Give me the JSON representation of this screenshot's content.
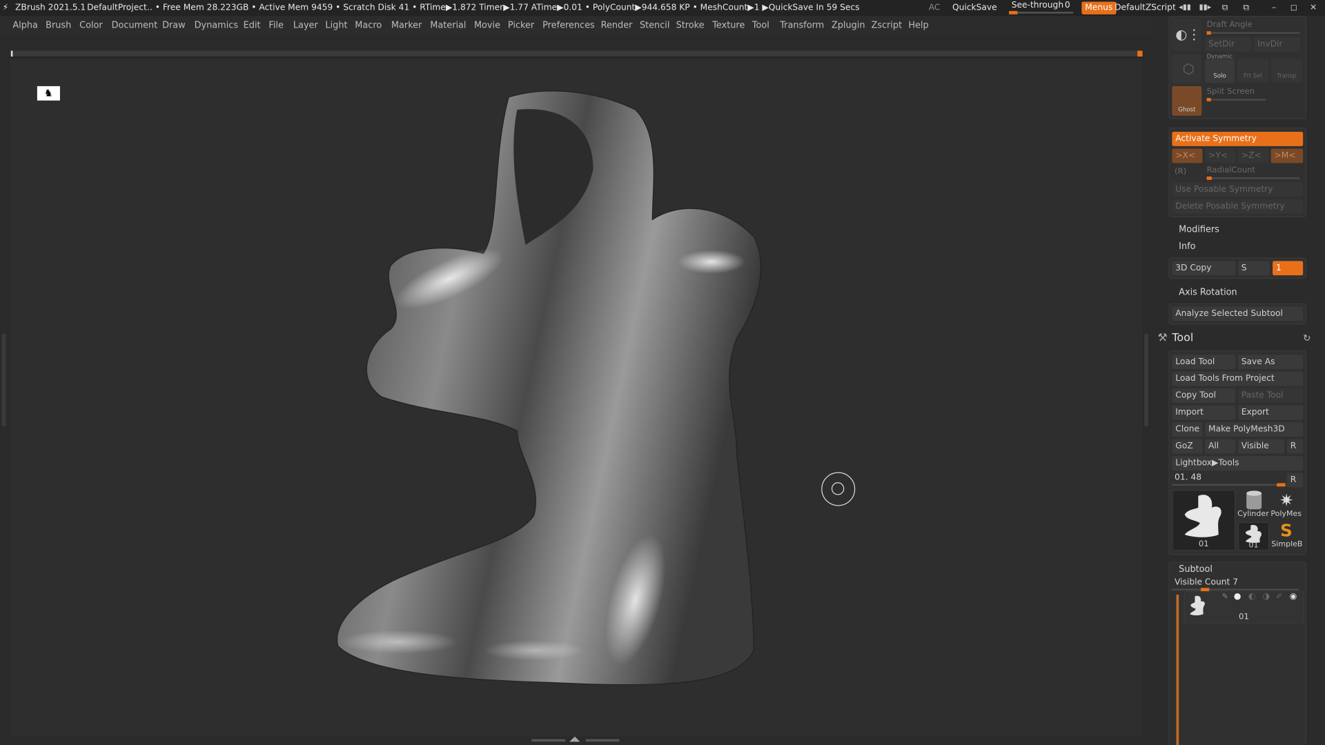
{
  "title_bar": {
    "app_version": "ZBrush 2021.5.1",
    "project": "DefaultProject",
    "stats": ".. • Free Mem 28.223GB • Active Mem 9459 • Scratch Disk 41 •  RTime▶1.872 Timer▶1.77 ATime▶0.01 • PolyCount▶944.658 KP  • MeshCount▶1  ▶QuickSave In 59 Secs",
    "ac": "AC",
    "quicksave": "QuickSave",
    "see_through_label": "See-through",
    "see_through_value": "0",
    "menus_button": "Menus",
    "default_zscript": "DefaultZScript",
    "accent_color": "#e8701a"
  },
  "menu_bar": {
    "items": [
      "Alpha",
      "Brush",
      "Color",
      "Document",
      "Draw",
      "Dynamics",
      "Edit",
      "File",
      "Layer",
      "Light",
      "Macro",
      "Marker",
      "Material",
      "Movie",
      "Picker",
      "Preferences",
      "Render",
      "Stencil",
      "Stroke",
      "Texture",
      "Tool",
      "Transform",
      "Zplugin",
      "Zscript",
      "Help"
    ]
  },
  "right_panel": {
    "top_tools": {
      "draft_angle": "Draft Angle",
      "setdir": "SetDir",
      "invdir": "InvDir",
      "dynamic": "Dynamic",
      "solo": "Solo",
      "frt_sel": "Frt Sel",
      "transp": "Transp",
      "ghost": "Ghost",
      "split_screen": "Split Screen"
    },
    "symmetry": {
      "activate": "Activate Symmetry",
      "x": ">X<",
      "y": ">Y<",
      "z": ">Z<",
      "m": ">M<",
      "r": "(R)",
      "radial_count": "RadialCount",
      "use_posable": "Use Posable Symmetry",
      "delete_posable": "Delete Posable Symmetry"
    },
    "modifiers": "Modifiers",
    "info": "Info",
    "copy3d": {
      "label": "3D Copy",
      "s": "S",
      "value": "1"
    },
    "axis_rotation": "Axis Rotation",
    "analyze": "Analyze Selected Subtool",
    "tool": {
      "title": "Tool",
      "load_tool": "Load Tool",
      "save_as": "Save As",
      "load_from_project": "Load Tools From Project",
      "copy_tool": "Copy Tool",
      "paste_tool": "Paste Tool",
      "import": "Import",
      "export": "Export",
      "clone": "Clone",
      "make_polymesh": "Make PolyMesh3D",
      "goz": "GoZ",
      "all": "All",
      "visible": "Visible",
      "r": "R",
      "lightbox": "Lightbox▶Tools",
      "current": "01. 48",
      "current_r": "R",
      "thumbs": [
        "01",
        "Cylinder",
        "PolyMes",
        "01",
        "SimpleB"
      ]
    },
    "subtool": {
      "title": "Subtool",
      "visible_count": "Visible Count 7",
      "item": "01"
    }
  }
}
